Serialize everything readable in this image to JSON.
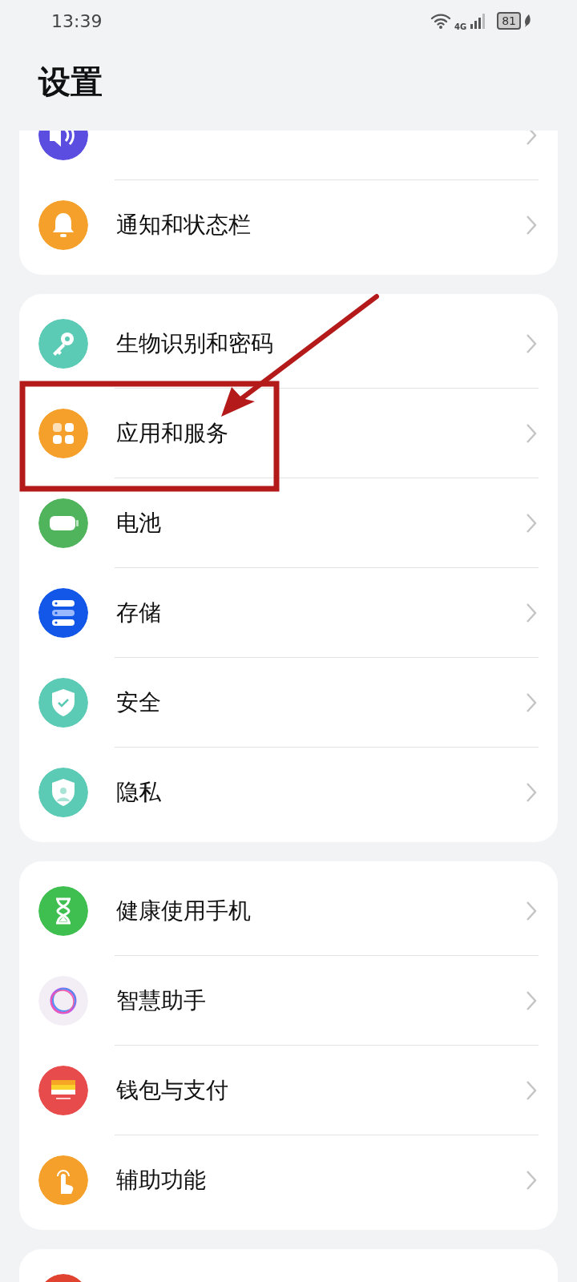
{
  "status_bar": {
    "time": "13:39",
    "network": "4G",
    "battery": "81"
  },
  "title": "设置",
  "groups": [
    {
      "items": [
        {
          "color": "#5b4de0"
        },
        {
          "label": "通知和状态栏",
          "color": "#f5a02a"
        }
      ]
    },
    {
      "items": [
        {
          "label": "生物识别和密码",
          "color": "#5ccbb5"
        },
        {
          "label": "应用和服务",
          "color": "#f5a02a"
        },
        {
          "label": "电池",
          "color": "#4fb45b"
        },
        {
          "label": "存储",
          "color": "#1257e8"
        },
        {
          "label": "安全",
          "color": "#5ccbb5"
        },
        {
          "label": "隐私",
          "color": "#5ccbb5"
        }
      ]
    },
    {
      "items": [
        {
          "label": "健康使用手机",
          "color": "#3fbf4f"
        },
        {
          "label": "智慧助手",
          "color": "#f3eef6"
        },
        {
          "label": "钱包与支付",
          "color": "#e84b4b"
        },
        {
          "label": "辅助功能",
          "color": "#f5a02a"
        }
      ]
    },
    {
      "items": [
        {
          "color": "#e0432f"
        }
      ]
    }
  ],
  "annotation": {
    "box": true,
    "arrow": true
  }
}
